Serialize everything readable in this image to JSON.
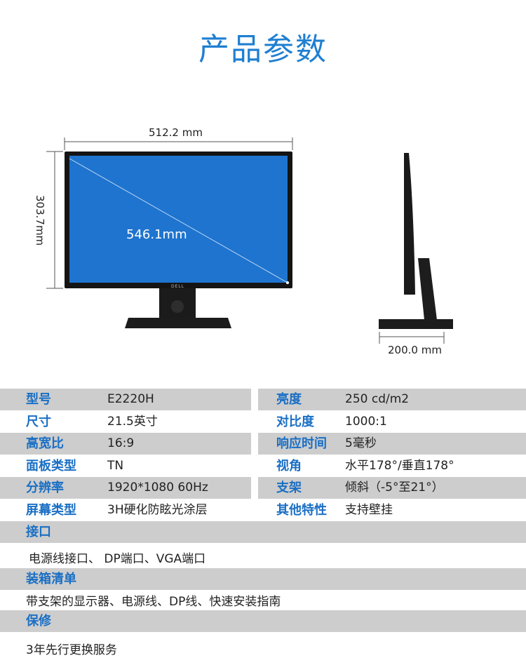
{
  "title": "产品参数",
  "dimensions": {
    "width": "512.2 mm",
    "height": "303.7mm",
    "diagonal": "546.1mm",
    "depth": "200.0 mm",
    "brand": "DELL"
  },
  "specs": [
    {
      "label_l": "型号",
      "value_l": "E2220H",
      "label_r": "亮度",
      "value_r": "250 cd/m2"
    },
    {
      "label_l": "尺寸",
      "value_l": "21.5英寸",
      "label_r": "对比度",
      "value_r": "1000:1"
    },
    {
      "label_l": "高宽比",
      "value_l": "16:9",
      "label_r": "响应时间",
      "value_r": "5毫秒"
    },
    {
      "label_l": "面板类型",
      "value_l": "TN",
      "label_r": "视角",
      "value_r": "水平178°/垂直178°"
    },
    {
      "label_l": "分辨率",
      "value_l": "1920*1080  60Hz",
      "label_r": "支架",
      "value_r": "倾斜（-5°至21°）"
    },
    {
      "label_l": "屏幕类型",
      "value_l": "3H硬化防眩光涂层",
      "label_r": "其他特性",
      "value_r": "支持壁挂"
    }
  ],
  "sections": {
    "interface_label": "接口",
    "interface_value": "电源线接口、 DP端口、VGA端口",
    "box_label": "装箱清单",
    "box_value": "带支架的显示器、电源线、DP线、快速安装指南",
    "warranty_label": "保修",
    "warranty_value": "3年先行更换服务"
  },
  "colors": {
    "accent": "#1f7fd1",
    "label": "#1a6fc4",
    "screen": "#1e74cf",
    "row_gray": "#cdcdcd"
  }
}
